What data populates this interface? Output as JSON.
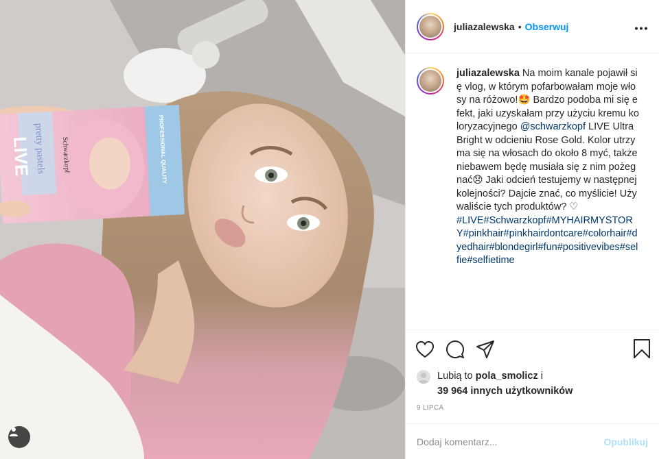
{
  "header": {
    "username": "juliazalewska",
    "separator": "•",
    "follow_label": "Obserwuj",
    "more_label": "•••"
  },
  "caption": {
    "username": "juliazalewska",
    "text_part1": " Na moim kanale pojawił się vlog, w którym pofarbowałam moje włosy na różowo!",
    "emoji1": "🤩",
    "text_part2": " Bardzo podoba mi się efekt, jaki uzyskałam przy użyciu kremu koloryzacyjnego ",
    "mention": "@schwarzkopf",
    "text_part3": " LIVE Ultra Bright w odcieniu Rose Gold. Kolor utrzyma się na włosach do około 8 myć, także niebawem będę musiała się z nim pożegnać",
    "emoji2": "😞",
    "text_part4": " Jaki odcień testujemy w następnej kolejności? Dajcie znać, co myślicie! Używaliście tych produktów? ",
    "heart": "♡",
    "hashtags": "#LIVE#Schwarzkopf#MYHAIRMYSTORY#pinkhair#pinkhairdontcare#colorhair#dyedhair#blondegirl#fun#positivevibes#selfie#selfietime"
  },
  "likes": {
    "prefix": "Lubią to ",
    "user": "pola_smolicz",
    "suffix": " i",
    "others": "39 964 innych użytkowników"
  },
  "date": "9 LIPCA",
  "add_comment": {
    "placeholder": "Dodaj komentarz...",
    "post_label": "Opublikuj"
  },
  "photo": {
    "product_brand": "LIVE",
    "product_line": "pretty pastels",
    "product_maker": "Schwarzkopf",
    "product_side": "PROFESSIONAL QUALITY"
  },
  "colors": {
    "accent": "#0095f6",
    "link": "#00376b",
    "muted": "#8e8e8e",
    "post_disabled": "#b2dffc"
  },
  "icons": [
    "heart-icon",
    "comment-icon",
    "share-icon",
    "bookmark-icon",
    "user-tag-icon",
    "more-icon"
  ]
}
